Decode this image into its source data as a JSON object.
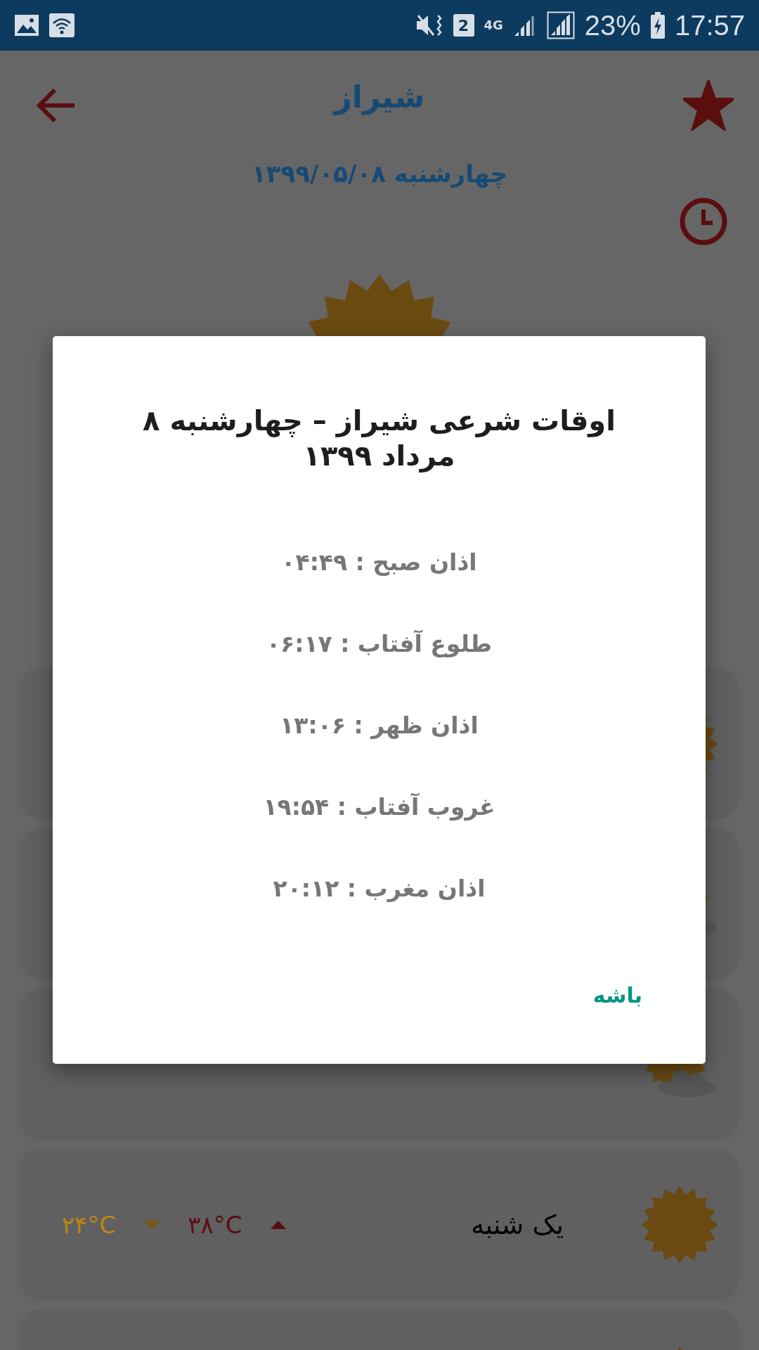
{
  "status_bar": {
    "sim": "2",
    "network": "4G",
    "battery": "23%",
    "time": "17:57"
  },
  "header": {
    "city": "شیراز",
    "date": "چهارشنبه ۱۳۹۹/۰۵/۰۸",
    "favorite": true
  },
  "current": {
    "kind": "sun"
  },
  "forecast": [
    {
      "kind": "sun"
    },
    {
      "kind": "cloudy"
    },
    {
      "kind": "cloudy"
    },
    {
      "kind": "sun",
      "day": "یک شنبه",
      "max": "۳۸°C",
      "min": "۲۴°C"
    },
    {
      "kind": "sun"
    }
  ],
  "dialog": {
    "title": "اوقات شرعی شیراز – چهارشنبه ۸ مرداد ۱۳۹۹",
    "times": [
      "اذان صبح : ۰۴:۴۹",
      "طلوع آفتاب : ۰۶:۱۷",
      "اذان ظهر : ۱۳:۰۶",
      "غروب آفتاب : ۱۹:۵۴",
      "اذان مغرب : ۲۰:۱۲"
    ],
    "button": "باشه"
  }
}
